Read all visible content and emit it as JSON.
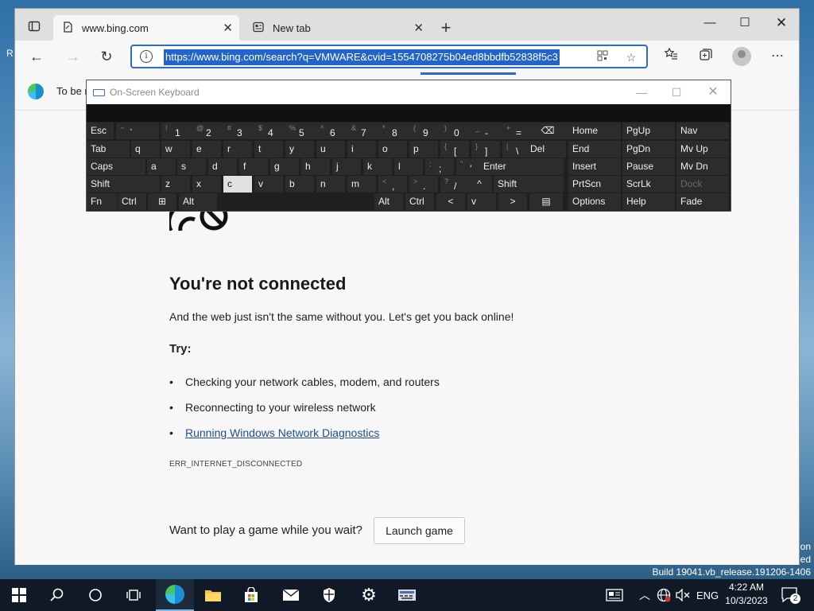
{
  "desktop": {
    "left_text": "R",
    "right_texts": [
      "on",
      "ed"
    ],
    "build": "Build 19041.vb_release.191206-1406"
  },
  "browser": {
    "tabs": [
      {
        "title": "www.bing.com",
        "icon": "page-icon"
      },
      {
        "title": "New tab",
        "icon": "newtab-icon"
      }
    ],
    "new_tab_symbol": "+",
    "address": "https://www.bing.com/search?q=VMWARE&cvid=1554708275b04ed8bbdfb52838f5c3",
    "infobar_text": "To be r"
  },
  "osk": {
    "title": "On-Screen Keyboard",
    "rows": [
      [
        {
          "m": "Esc"
        },
        {
          "s": "~",
          "m": "`"
        },
        {
          "s": "!",
          "m": "1"
        },
        {
          "s": "@",
          "m": "2"
        },
        {
          "s": "#",
          "m": "3"
        },
        {
          "s": "$",
          "m": "4"
        },
        {
          "s": "%",
          "m": "5"
        },
        {
          "s": "^",
          "m": "6"
        },
        {
          "s": "&",
          "m": "7"
        },
        {
          "s": "*",
          "m": "8"
        },
        {
          "s": "(",
          "m": "9"
        },
        {
          "s": ")",
          "m": "0"
        },
        {
          "s": "_",
          "m": "-"
        },
        {
          "s": "+",
          "m": "="
        },
        {
          "m": "⌫"
        },
        {
          "m": "Home"
        },
        {
          "m": "PgUp"
        },
        {
          "m": "Nav"
        }
      ],
      [
        {
          "m": "Tab"
        },
        {
          "m": "q"
        },
        {
          "m": "w"
        },
        {
          "m": "e"
        },
        {
          "m": "r"
        },
        {
          "m": "t"
        },
        {
          "m": "y"
        },
        {
          "m": "u"
        },
        {
          "m": "i"
        },
        {
          "m": "o"
        },
        {
          "m": "p"
        },
        {
          "s": "{",
          "m": "["
        },
        {
          "s": "}",
          "m": "]"
        },
        {
          "s": "|",
          "m": "\\"
        },
        {
          "m": "Del"
        },
        {
          "m": "End"
        },
        {
          "m": "PgDn"
        },
        {
          "m": "Mv Up"
        }
      ],
      [
        {
          "m": "Caps"
        },
        {
          "m": "a"
        },
        {
          "m": "s"
        },
        {
          "m": "d"
        },
        {
          "m": "f"
        },
        {
          "m": "g"
        },
        {
          "m": "h"
        },
        {
          "m": "j"
        },
        {
          "m": "k"
        },
        {
          "m": "l"
        },
        {
          "s": ":",
          "m": ";"
        },
        {
          "s": "\"",
          "m": "'"
        },
        {
          "m": "Enter"
        },
        {
          "m": "Insert"
        },
        {
          "m": "Pause"
        },
        {
          "m": "Mv Dn"
        }
      ],
      [
        {
          "m": "Shift"
        },
        {
          "m": "z"
        },
        {
          "m": "x"
        },
        {
          "m": "c"
        },
        {
          "m": "v"
        },
        {
          "m": "b"
        },
        {
          "m": "n"
        },
        {
          "m": "m"
        },
        {
          "s": "<",
          "m": ","
        },
        {
          "s": ">",
          "m": "."
        },
        {
          "s": "?",
          "m": "/"
        },
        {
          "m": "^"
        },
        {
          "m": "Shift"
        },
        {
          "m": "PrtScn"
        },
        {
          "m": "ScrLk"
        },
        {
          "m": "Dock"
        }
      ],
      [
        {
          "m": "Fn"
        },
        {
          "m": "Ctrl"
        },
        {
          "m": "⊞"
        },
        {
          "m": "Alt"
        },
        {
          "m": "Alt"
        },
        {
          "m": "Ctrl"
        },
        {
          "m": "<"
        },
        {
          "m": "v"
        },
        {
          "m": ">"
        },
        {
          "m": "▤"
        },
        {
          "m": "Options"
        },
        {
          "m": "Help"
        },
        {
          "m": "Fade"
        }
      ]
    ],
    "highlighted_key": "c",
    "dimmed_key": "Dock"
  },
  "page": {
    "title": "You're not connected",
    "subtitle": "And the web just isn't the same without you. Let's get you back online!",
    "try_label": "Try:",
    "tips": [
      "Checking your network cables, modem, and routers",
      "Reconnecting to your wireless network"
    ],
    "diagnostics_link": "Running Windows Network Diagnostics",
    "error_code": "ERR_INTERNET_DISCONNECTED",
    "game_question": "Want to play a game while you wait?",
    "game_button": "Launch game"
  },
  "taskbar": {
    "language": "ENG",
    "time": "4:22 AM",
    "date": "10/3/2023",
    "notifications": "2"
  }
}
